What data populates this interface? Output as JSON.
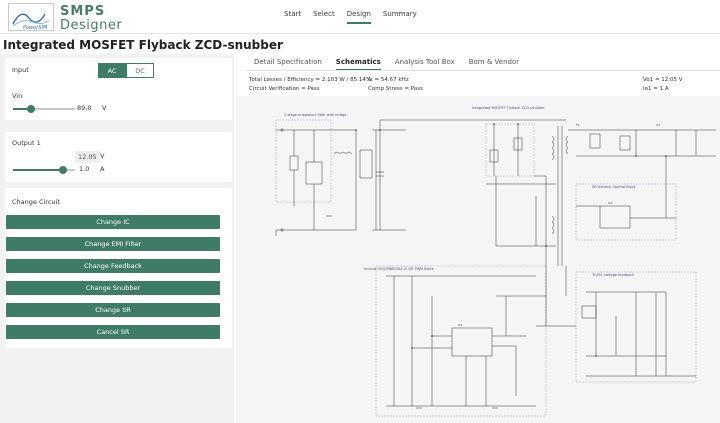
{
  "logo": {
    "line1": "SMPS",
    "line2": "Designer",
    "mark": "PowerSIM"
  },
  "nav": [
    {
      "label": "Start"
    },
    {
      "label": "Select"
    },
    {
      "label": "Design",
      "active": true
    },
    {
      "label": "Summary"
    }
  ],
  "page_title": "Integrated MOSFET Flyback ZCD-snubber",
  "input": {
    "heading": "Input",
    "mode_ac": "AC",
    "mode_dc": "DC",
    "selected_mode": "AC",
    "vin_label": "Vin",
    "vin_value": "89.0",
    "vin_unit": "V",
    "vin_slider_fraction": 0.1
  },
  "output": {
    "heading": "Output 1",
    "voltage_value": "12.05",
    "voltage_unit": "V",
    "current_value": "1.0",
    "current_unit": "A",
    "current_slider_fraction": 0.75
  },
  "change": {
    "heading": "Change Circuit",
    "buttons": [
      "Change IC",
      "Change EMI Filter",
      "Change Feedback",
      "Change Snubber",
      "Change SR",
      "Cancel SR"
    ]
  },
  "tabs": [
    {
      "label": "Detail Specification"
    },
    {
      "label": "Schematics",
      "active": true
    },
    {
      "label": "Analysis Tool Box"
    },
    {
      "label": "Bom & Vendor"
    }
  ],
  "info": {
    "losses": "Total Losses / Efficiency = 2.103 W / 85.14%",
    "verification": "Circuit Verification = Pass",
    "fs": "fs = 54.67 kHz",
    "comp": "Comp Stress = Pass",
    "vo1": "Vo1 = 12.05 V",
    "io1": "Io1 = 1 A"
  },
  "schematic": {
    "label_emi": "1 stage unbalance filter with bridge",
    "label_ic": "Integrated MOSFET Flyback ZCD-snubber",
    "label_sr": "SR Generic Control Block",
    "label_pwm": "Include IC01/P88034A IC QR PWM Block",
    "label_fb": "TL431 voltage feedback",
    "label_t1": "T1",
    "label_u1": "U1",
    "label_u2": "U2",
    "label_u3": "U3",
    "accent": "#4a4a8a"
  },
  "colors": {
    "accent": "#3f7b67",
    "panel": "#f2f2f2"
  }
}
